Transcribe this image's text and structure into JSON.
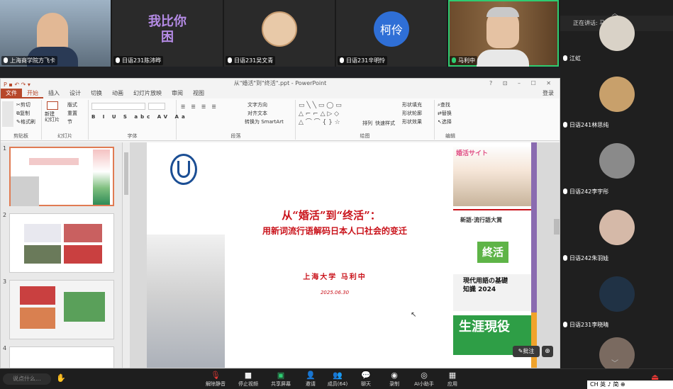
{
  "video_strip": [
    {
      "name": "上海商学院方飞卡",
      "kind": "camera",
      "color": "#6b7f93"
    },
    {
      "name": "日语231陈沛晔",
      "kind": "text-avatar",
      "avatar_text": "我比你困",
      "color": "#2b2b2b"
    },
    {
      "name": "日语231吴文青",
      "kind": "image-avatar",
      "color": "#e8c9a8"
    },
    {
      "name": "日语231辛明怜",
      "kind": "initials",
      "avatar_text": "柯伶",
      "color": "#2f6fd6"
    },
    {
      "name": "马利中",
      "kind": "camera",
      "color": "#7b5c3c",
      "active": true
    }
  ],
  "right_panel": {
    "speaker_label": "正在讲话: 马利中",
    "participants": [
      {
        "name": "江虹",
        "color": "#d9d2c7"
      },
      {
        "name": "日语241林思纯",
        "color": "#c8a06b"
      },
      {
        "name": "日语242李宇彤",
        "color": "#8a8a8a"
      },
      {
        "name": "日语242朱羽娃",
        "color": "#d5b9a8"
      },
      {
        "name": "日语231李晓晴",
        "color": "#203245"
      },
      {
        "name": "",
        "color": "#7a6a60"
      }
    ]
  },
  "ppt": {
    "window_title": "从\"婚活\"到\"终活\".ppt - PowerPoint",
    "window_controls": "?  ⊡  –  ☐  ✕",
    "login": "登录",
    "tabs": [
      "文件",
      "开始",
      "插入",
      "设计",
      "切换",
      "动画",
      "幻灯片放映",
      "审阅",
      "视图"
    ],
    "ribbon": {
      "clipboard": {
        "paste": "粘贴",
        "cut": "剪切",
        "copy": "复制",
        "format": "格式刷",
        "label": "剪贴板"
      },
      "slides": {
        "new": "新建\n幻灯片",
        "layout": "版式",
        "reset": "重置",
        "section": "节",
        "label": "幻灯片"
      },
      "font": {
        "label": "字体"
      },
      "paragraph": {
        "dir": "文字方向",
        "align": "对齐文本",
        "smartart": "转换为 SmartArt",
        "label": "段落"
      },
      "drawing": {
        "arrange": "排列",
        "quick": "快速样式",
        "fill": "形状填充",
        "outline": "形状轮廓",
        "effect": "形状效果",
        "label": "绘图"
      },
      "editing": {
        "find": "查找",
        "replace": "替换",
        "select": "选择",
        "label": "编辑"
      }
    },
    "thumb_numbers": [
      "1",
      "2",
      "3",
      "4"
    ],
    "slide": {
      "title_line1": "从“婚活”到“终活”：",
      "title_line2": "用新词流行语解码日本人口社会的变迁",
      "author": "上海大学  马利中",
      "date": "2025.06.30",
      "side_label1": "婚活サイト",
      "side_label2": "新語·流行語大賞",
      "side_label3": "終活",
      "side_label4": "現代用語の基礎知識 2024",
      "side_label5": "生涯現役"
    },
    "annotate_label": "批注",
    "zoom_icon": "zoom-in-icon"
  },
  "toolbar": {
    "chat_placeholder": "说点什么...",
    "buttons": [
      "解除静音",
      "停止视频",
      "共享屏幕",
      "邀请",
      "成员(64)",
      "聊天",
      "录制",
      "AI小助手",
      "应用"
    ]
  },
  "ime_bar": "CH  英 ♪ 简 ⊕"
}
